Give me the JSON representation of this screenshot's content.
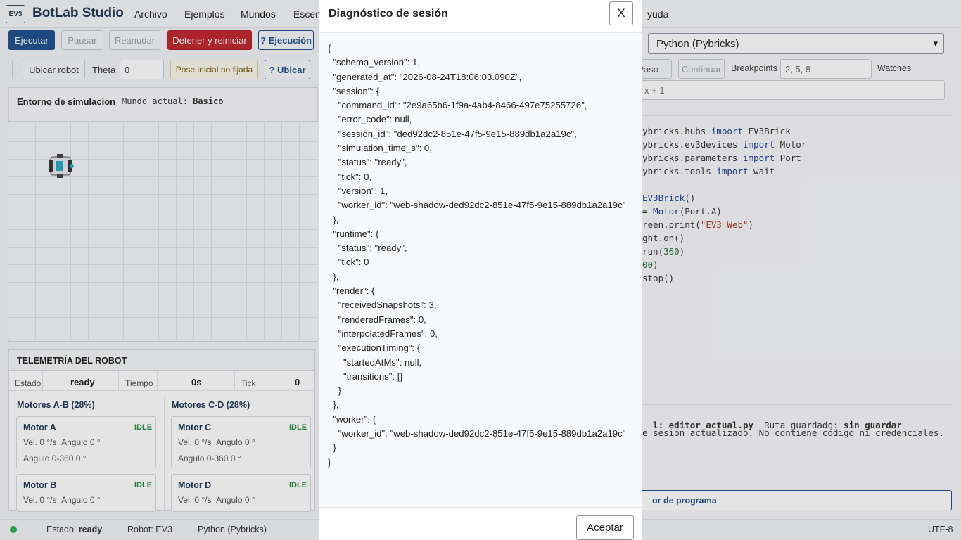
{
  "app": {
    "logo": "EV3",
    "name": "BotLab Studio"
  },
  "menu": [
    "Archivo",
    "Ejemplos",
    "Mundos",
    "Escena",
    "Ayuda"
  ],
  "menu_visible_right": "yuda",
  "toolbar": {
    "run": "Ejecutar",
    "pause": "Pausar",
    "resume": "Reanudar",
    "stop_reset": "Detener y reiniciar",
    "exec_help": "? Ejecución",
    "locate_robot": "Ubicar robot",
    "theta_label": "Theta",
    "theta_value": "0",
    "pose_status": "Pose inicial no fijada",
    "locate_help": "? Ubicar"
  },
  "sim": {
    "title": "Entorno de simulacion",
    "world_label": "Mundo actual:",
    "world_value": "Basico"
  },
  "telemetry": {
    "title": "TELEMETRÍA DEL ROBOT",
    "estado_label": "Estado",
    "estado_value": "ready",
    "tiempo_label": "Tiempo",
    "tiempo_value": "0s",
    "tick_label": "Tick",
    "tick_value": "0",
    "group_ab": "Motores A-B (28%)",
    "group_cd": "Motores C-D (28%)",
    "motors": [
      {
        "name": "Motor A",
        "state": "IDLE",
        "vel_label": "Vel.",
        "vel": "0 °/s",
        "angle_label": "Angulo",
        "angle": "0 °",
        "angle360_label": "Angulo 0-360",
        "angle360": "0 °"
      },
      {
        "name": "Motor C",
        "state": "IDLE",
        "vel_label": "Vel.",
        "vel": "0 °/s",
        "angle_label": "Angulo",
        "angle": "0 °",
        "angle360_label": "Angulo 0-360",
        "angle360": "0 °"
      },
      {
        "name": "Motor B",
        "state": "IDLE",
        "vel_label": "Vel.",
        "vel": "0 °/s",
        "angle_label": "Angulo",
        "angle": "0 °"
      },
      {
        "name": "Motor D",
        "state": "IDLE",
        "vel_label": "Vel.",
        "vel": "0 °/s",
        "angle_label": "Angulo",
        "angle": "0 °"
      }
    ]
  },
  "editor": {
    "language": "Python (Pybricks)",
    "step": "Paso",
    "continue": "Continuar",
    "breakpoints_label": "Breakpoints",
    "breakpoints_value": "2, 5, 8",
    "watches_label": "Watches",
    "watch_expr": "x + 1",
    "file_label": "l:",
    "file_value": "editor_actual.py",
    "save_label": "Ruta guardado:",
    "save_value": "sin guardar",
    "console_text": "e sesión actualizado. No contiene código ni credenciales.",
    "program_tab": "or de programa"
  },
  "modal": {
    "title": "Diagnóstico de sesión",
    "close": "X",
    "json_text": "{\n  \"schema_version\": 1,\n  \"generated_at\": \"2026-08-24T18:06:03.090Z\",\n  \"session\": {\n    \"command_id\": \"2e9a65b6-1f9a-4ab4-8466-497e75255726\",\n    \"error_code\": null,\n    \"session_id\": \"ded92dc2-851e-47f5-9e15-889db1a2a19c\",\n    \"simulation_time_s\": 0,\n    \"status\": \"ready\",\n    \"tick\": 0,\n    \"version\": 1,\n    \"worker_id\": \"web-shadow-ded92dc2-851e-47f5-9e15-889db1a2a19c\"\n  },\n  \"runtime\": {\n    \"status\": \"ready\",\n    \"tick\": 0\n  },\n  \"render\": {\n    \"receivedSnapshots\": 3,\n    \"renderedFrames\": 0,\n    \"interpolatedFrames\": 0,\n    \"executionTiming\": {\n      \"startedAtMs\": null,\n      \"transitions\": []\n    }\n  },\n  \"worker\": {\n    \"worker_id\": \"web-shadow-ded92dc2-851e-47f5-9e15-889db1a2a19c\"\n  }\n}",
    "accept": "Aceptar"
  },
  "status": {
    "estado_label": "Estado:",
    "estado_value": "ready",
    "robot": "Robot: EV3",
    "language": "Python (Pybricks)",
    "encoding": "UTF-8",
    "dot_color": "#2fae4f"
  }
}
